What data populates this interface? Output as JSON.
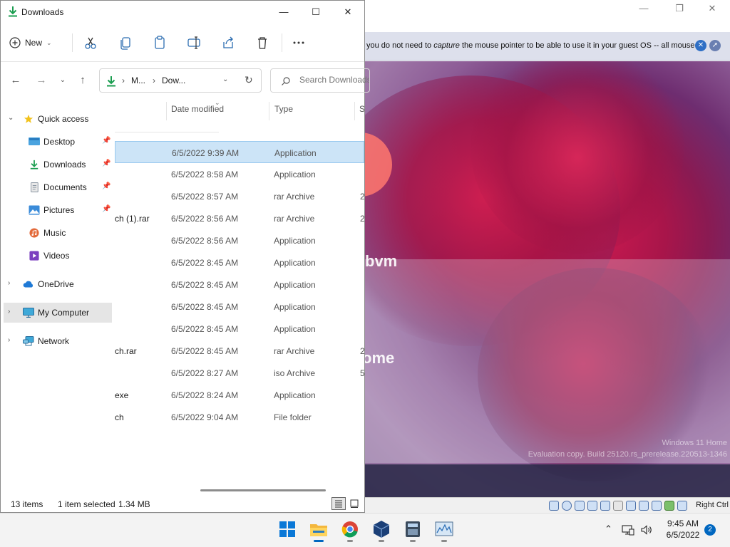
{
  "vbox": {
    "notice_before": "you do not need to ",
    "notice_em": "capture",
    "notice_after": " the mouse pointer to be able to use it in your guest OS -- all mouse",
    "host_key": "Right Ctrl",
    "guest": {
      "ghost_text_1": "bvm",
      "ghost_text_2": "ome",
      "watermark_line1": "Windows 11 Home",
      "watermark_line2": "Evaluation copy. Build 25120.rs_prerelease.220513-1346"
    }
  },
  "explorer": {
    "title": "Downloads",
    "command_bar": {
      "new_label": "New",
      "tools": [
        "cut-icon",
        "copy-icon",
        "paste-icon",
        "rename-icon",
        "share-icon",
        "delete-icon",
        "more-icon"
      ]
    },
    "nav": {
      "breadcrumb": [
        "M...",
        "Dow..."
      ],
      "search_placeholder": "Search Downloads"
    },
    "sidebar": {
      "quick_access": "Quick access",
      "items": [
        {
          "label": "Desktop",
          "pinned": true
        },
        {
          "label": "Downloads",
          "pinned": true
        },
        {
          "label": "Documents",
          "pinned": true
        },
        {
          "label": "Pictures",
          "pinned": true
        },
        {
          "label": "Music",
          "pinned": false
        },
        {
          "label": "Videos",
          "pinned": false
        }
      ],
      "onedrive": "OneDrive",
      "my_computer": "My Computer",
      "network": "Network"
    },
    "columns": {
      "date": "Date modified",
      "type": "Type",
      "size": "Si"
    },
    "files": [
      {
        "name": "",
        "date": "6/5/2022 9:39 AM",
        "type": "Application",
        "size": "",
        "selected": true
      },
      {
        "name": "",
        "date": "6/5/2022 8:58 AM",
        "type": "Application",
        "size": ""
      },
      {
        "name": "",
        "date": "6/5/2022 8:57 AM",
        "type": "rar Archive",
        "size": "2"
      },
      {
        "name": "ch (1).rar",
        "date": "6/5/2022 8:56 AM",
        "type": "rar Archive",
        "size": "2"
      },
      {
        "name": "",
        "date": "6/5/2022 8:56 AM",
        "type": "Application",
        "size": ""
      },
      {
        "name": "",
        "date": "6/5/2022 8:45 AM",
        "type": "Application",
        "size": ""
      },
      {
        "name": "",
        "date": "6/5/2022 8:45 AM",
        "type": "Application",
        "size": ""
      },
      {
        "name": "",
        "date": "6/5/2022 8:45 AM",
        "type": "Application",
        "size": ""
      },
      {
        "name": "",
        "date": "6/5/2022 8:45 AM",
        "type": "Application",
        "size": ""
      },
      {
        "name": "ch.rar",
        "date": "6/5/2022 8:45 AM",
        "type": "rar Archive",
        "size": "2"
      },
      {
        "name": "",
        "date": "6/5/2022 8:27 AM",
        "type": "iso Archive",
        "size": "5"
      },
      {
        "name": "exe",
        "date": "6/5/2022 8:24 AM",
        "type": "Application",
        "size": ""
      },
      {
        "name": "ch",
        "date": "6/5/2022 9:04 AM",
        "type": "File folder",
        "size": ""
      }
    ],
    "status": {
      "count": "13 items",
      "selection": "1 item selected",
      "size": "1.34 MB"
    }
  },
  "taskbar": {
    "apps": [
      "windows-start-icon",
      "file-explorer-icon",
      "chrome-icon",
      "virtualbox-icon",
      "calculator-icon",
      "performance-monitor-icon"
    ],
    "time": "9:45 AM",
    "date": "6/5/2022",
    "notifications": "2"
  }
}
